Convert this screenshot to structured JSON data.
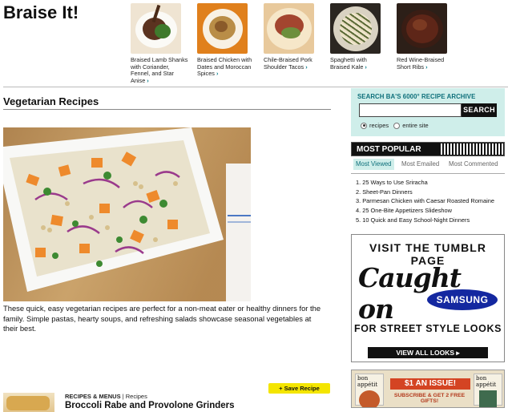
{
  "braise": {
    "title": "Braise It!",
    "arrow": "›",
    "items": [
      {
        "label": "Braised Lamb Shanks with Coriander, Fennel, and Star Anise"
      },
      {
        "label": "Braised Chicken with Dates and Moroccan Spices"
      },
      {
        "label": "Chile-Braised Pork Shoulder Tacos"
      },
      {
        "label": "Spaghetti with Braised Kale"
      },
      {
        "label": "Red Wine-Braised Short Ribs"
      }
    ]
  },
  "main": {
    "title": "Vegetarian Recipes",
    "intro": "These quick, easy vegetarian recipes are perfect for a non-meat eater or healthy dinners for the family. Simple pastas, hearty soups, and refreshing salads showcase seasonal vegetables at their best.",
    "result": {
      "category": "RECIPES & MENUS",
      "separator": " | ",
      "type": "Recipes",
      "title": "Broccoli Rabe and Provolone Grinders",
      "save_label": "+ Save Recipe"
    }
  },
  "search": {
    "heading": "SEARCH BA'S 6000° RECIPE ARCHIVE",
    "value": "",
    "button": "SEARCH",
    "scope_recipes": "recipes",
    "scope_site": "entire site"
  },
  "popular": {
    "title": "MOST POPULAR",
    "tabs": [
      "Most Viewed",
      "Most Emailed",
      "Most Commented"
    ],
    "items": [
      "1. 25 Ways to Use Sriracha",
      "2. Sheet-Pan Dinners",
      "3. Parmesan Chicken with Caesar Roasted Romaine",
      "4. 25 One-Bite Appetizers Slideshow",
      "5. 10 Quick and Easy School-Night Dinners"
    ]
  },
  "ad_tumblr": {
    "line1": "VISIT THE TUMBLR PAGE",
    "script": "Caught on",
    "brand": "SAMSUNG",
    "line2": "FOR STREET STYLE LOOKS",
    "cta": "VIEW ALL LOOKS ▸"
  },
  "ad_ba": {
    "mast_left": "bon appétit",
    "mast_right": "bon appétit",
    "offer": "$1 AN ISSUE!",
    "offer_sub": "SUBSCRIBE & GET 2 FREE GIFTS!"
  },
  "colors": {
    "accent": "#0d6f7a",
    "search_bg": "#cfeeea",
    "save_yellow": "#f4e500"
  }
}
